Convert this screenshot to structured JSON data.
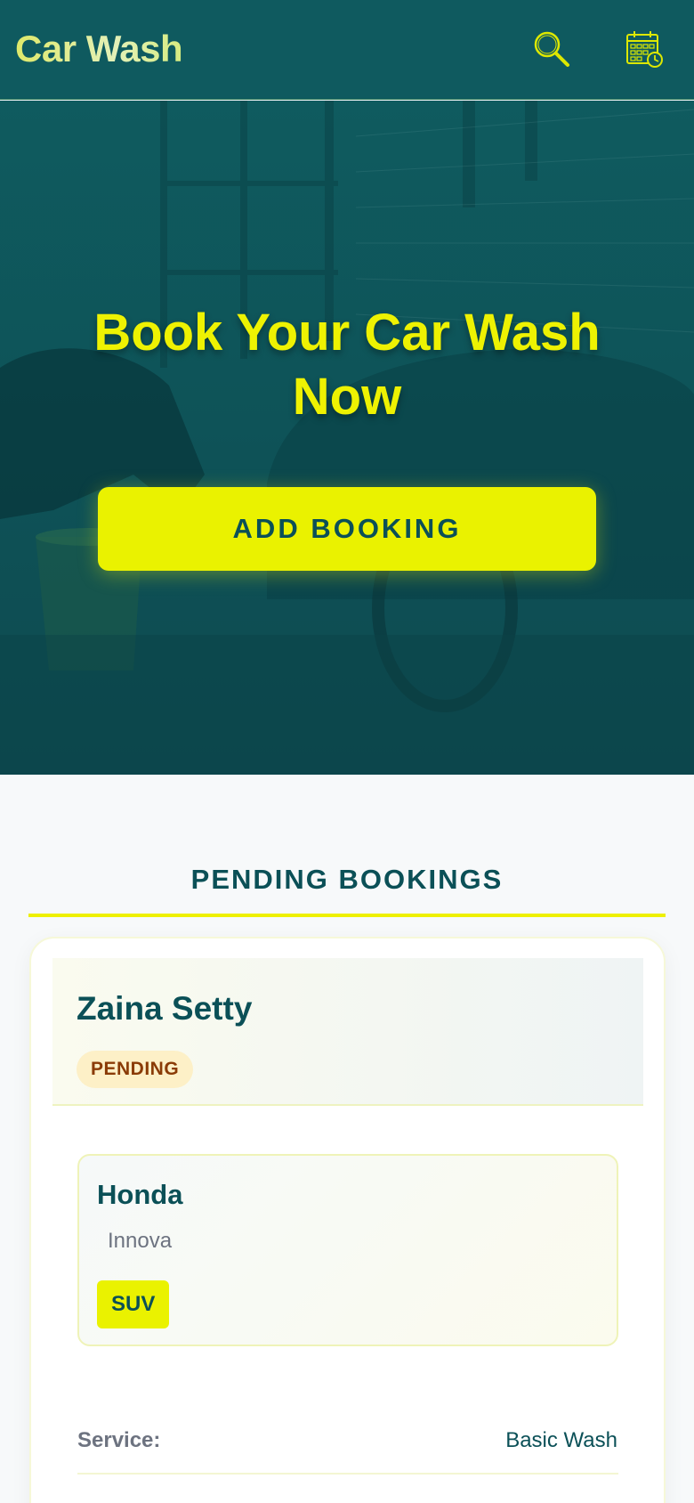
{
  "header": {
    "title": "Car Wash",
    "icons": [
      "search-icon",
      "calendar-icon"
    ]
  },
  "hero": {
    "title": "Book Your Car Wash Now",
    "button_label": "ADD BOOKING"
  },
  "section": {
    "title": "PENDING BOOKINGS"
  },
  "booking": {
    "customer_name": "Zaina Setty",
    "status": "PENDING",
    "vehicle": {
      "make": "Honda",
      "model": "Innova",
      "type": "SUV"
    },
    "details": [
      {
        "label": "Service:",
        "value": "Basic Wash"
      }
    ]
  },
  "colors": {
    "header_bg": "#0f5a5f",
    "accent_yellow": "#eaf200",
    "primary_teal": "#0b5057",
    "status_bg": "#fdf0c7",
    "status_text": "#8a3b06"
  }
}
